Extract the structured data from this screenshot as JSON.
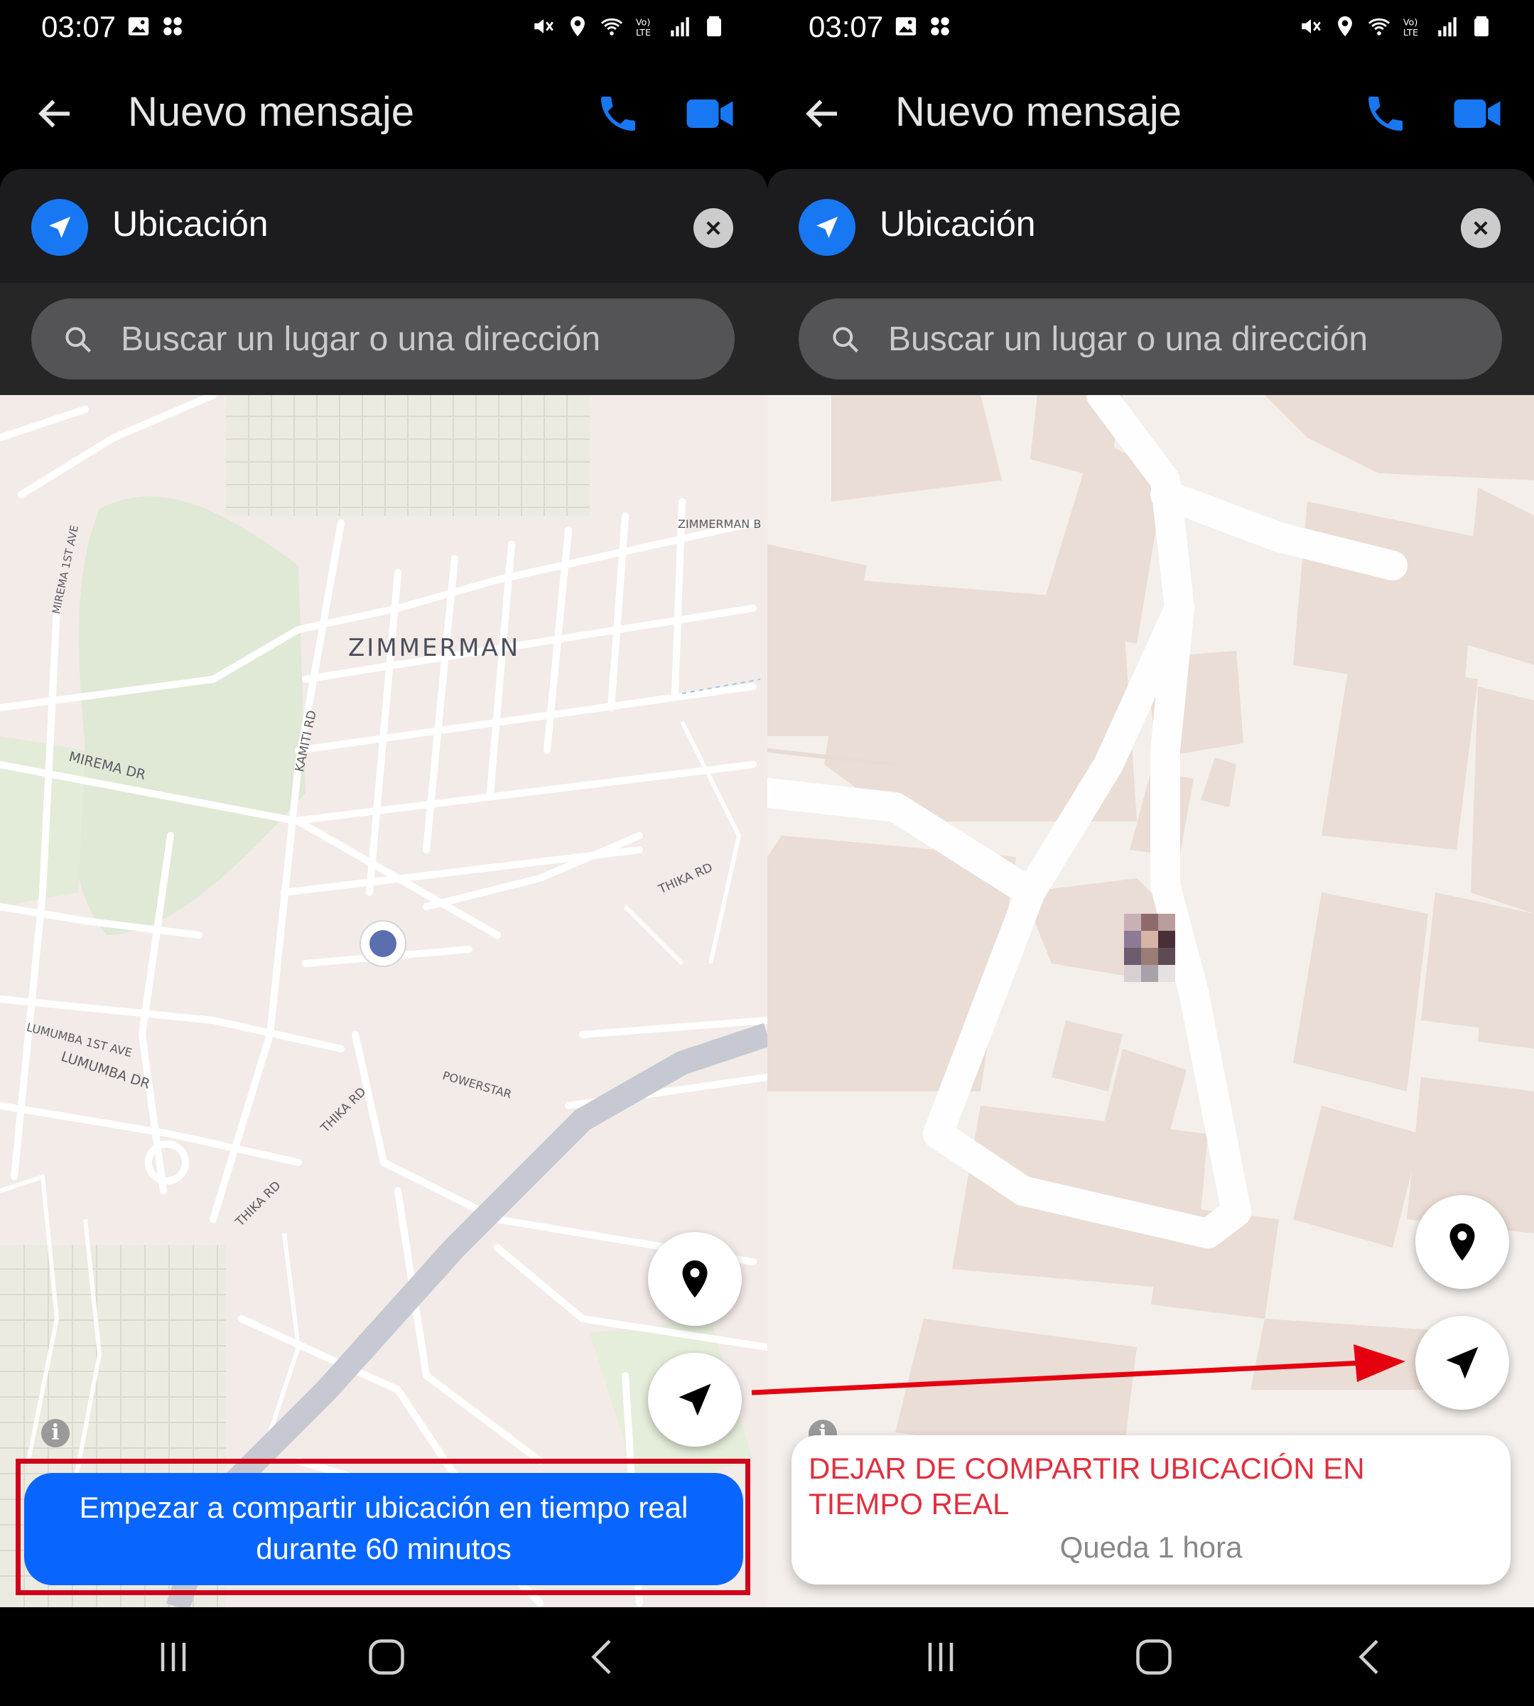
{
  "status": {
    "time": "03:07",
    "left_icons": [
      "gallery-icon",
      "apps-icon"
    ],
    "right_icons": [
      "mute-icon",
      "location-icon",
      "wifi-icon",
      "volte-icon",
      "signal-icon",
      "battery-icon"
    ]
  },
  "header": {
    "title": "Nuevo mensaje",
    "back_icon": "arrow-left-icon",
    "call_icon": "phone-icon",
    "video_icon": "video-camera-icon"
  },
  "location_bar": {
    "label": "Ubicación",
    "icon": "navigation-arrow-icon",
    "clear_icon": "close-icon"
  },
  "search": {
    "placeholder": "Buscar un lugar o una dirección"
  },
  "left_map": {
    "neighborhood": "ZIMMERMAN",
    "streets": [
      "ZIMMERMAN B",
      "MIREMA 1ST AVE",
      "MIREMA DR",
      "KAMITI RD",
      "THIKA RD",
      "LUMUMBA 1ST AVE",
      "LUMUMBA DR",
      "POWERSTAR",
      "THIKA RD",
      "THIKA RD"
    ]
  },
  "left_panel": {
    "share_line1": "Empezar a compartir ubicación en tiempo real",
    "share_line2": "durante 60 minutos",
    "highlight_color": "#d0021b"
  },
  "right_panel": {
    "stop_text": "DEJAR DE COMPARTIR UBICACIÓN EN TIEMPO REAL",
    "remaining": "Queda 1 hora"
  },
  "colors": {
    "accent": "#1877f2",
    "button_blue": "#0866ff",
    "stop_red": "#e0303f",
    "annotation_red": "#d0021b"
  },
  "nav": [
    "recent-apps-icon",
    "home-icon",
    "back-icon"
  ]
}
